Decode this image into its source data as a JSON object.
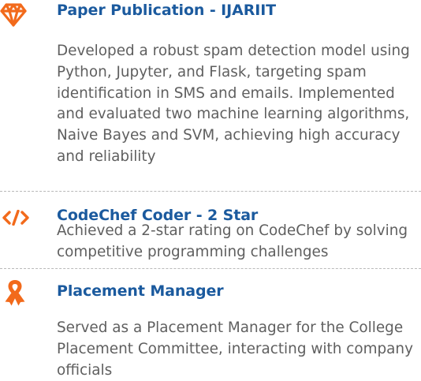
{
  "accent_icon_color": "#f26a1b",
  "title_color": "#1b5a9e",
  "text_color": "#5f5f5f",
  "entries": [
    {
      "icon": "gem-icon",
      "title": "Paper Publication - IJARIIT",
      "description": "Developed a robust spam detection model using Python, Jupyter, and Flask, targeting spam identification in SMS and emails. Implemented and evaluated two machine learning algorithms, Naive Bayes and SVM, achieving high accuracy and reliability"
    },
    {
      "icon": "code-icon",
      "title": "CodeChef Coder - 2 Star",
      "description": "Achieved a 2-star rating on CodeChef by solving competitive programming challenges"
    },
    {
      "icon": "ribbon-icon",
      "title": "Placement Manager",
      "description": "Served as a Placement Manager for the College Placement Committee, interacting with company officials"
    }
  ]
}
